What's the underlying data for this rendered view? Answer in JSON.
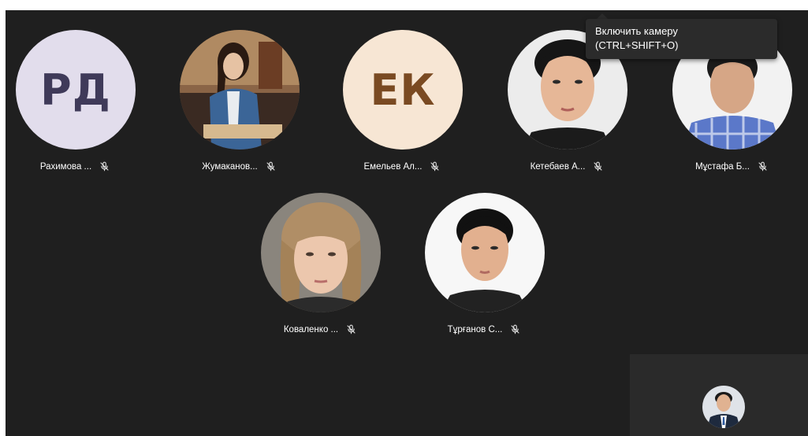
{
  "tooltip": {
    "line1": "Включить камеру",
    "line2": "(CTRL+SHIFT+O)"
  },
  "participants": [
    {
      "name": "Рахимова ...",
      "initials": "РД",
      "avatar": "initials",
      "bg": "#e2ddec",
      "fg": "#3f3a59"
    },
    {
      "name": "Жумаканов...",
      "avatar": "photo-woman-denim-jacket"
    },
    {
      "name": "Емельев Ал...",
      "initials": "ЕК",
      "avatar": "initials",
      "bg": "#f7e6d4",
      "fg": "#7a4a22"
    },
    {
      "name": "Кетебаев А...",
      "avatar": "photo-man-portrait"
    },
    {
      "name": "Мұстафа Б...",
      "avatar": "photo-man-plaid-shirt"
    },
    {
      "name": "Коваленко ...",
      "avatar": "photo-woman-bangs"
    },
    {
      "name": "Тұрғанов С...",
      "avatar": "photo-man-white-bg"
    }
  ],
  "self_view": {
    "avatar": "photo-man-suit"
  },
  "icons": {
    "mic": "mic-off-icon"
  },
  "colors": {
    "stage": "#1f1f1f",
    "tooltip": "#2b2b2b",
    "self_view": "#2a2a2a"
  }
}
